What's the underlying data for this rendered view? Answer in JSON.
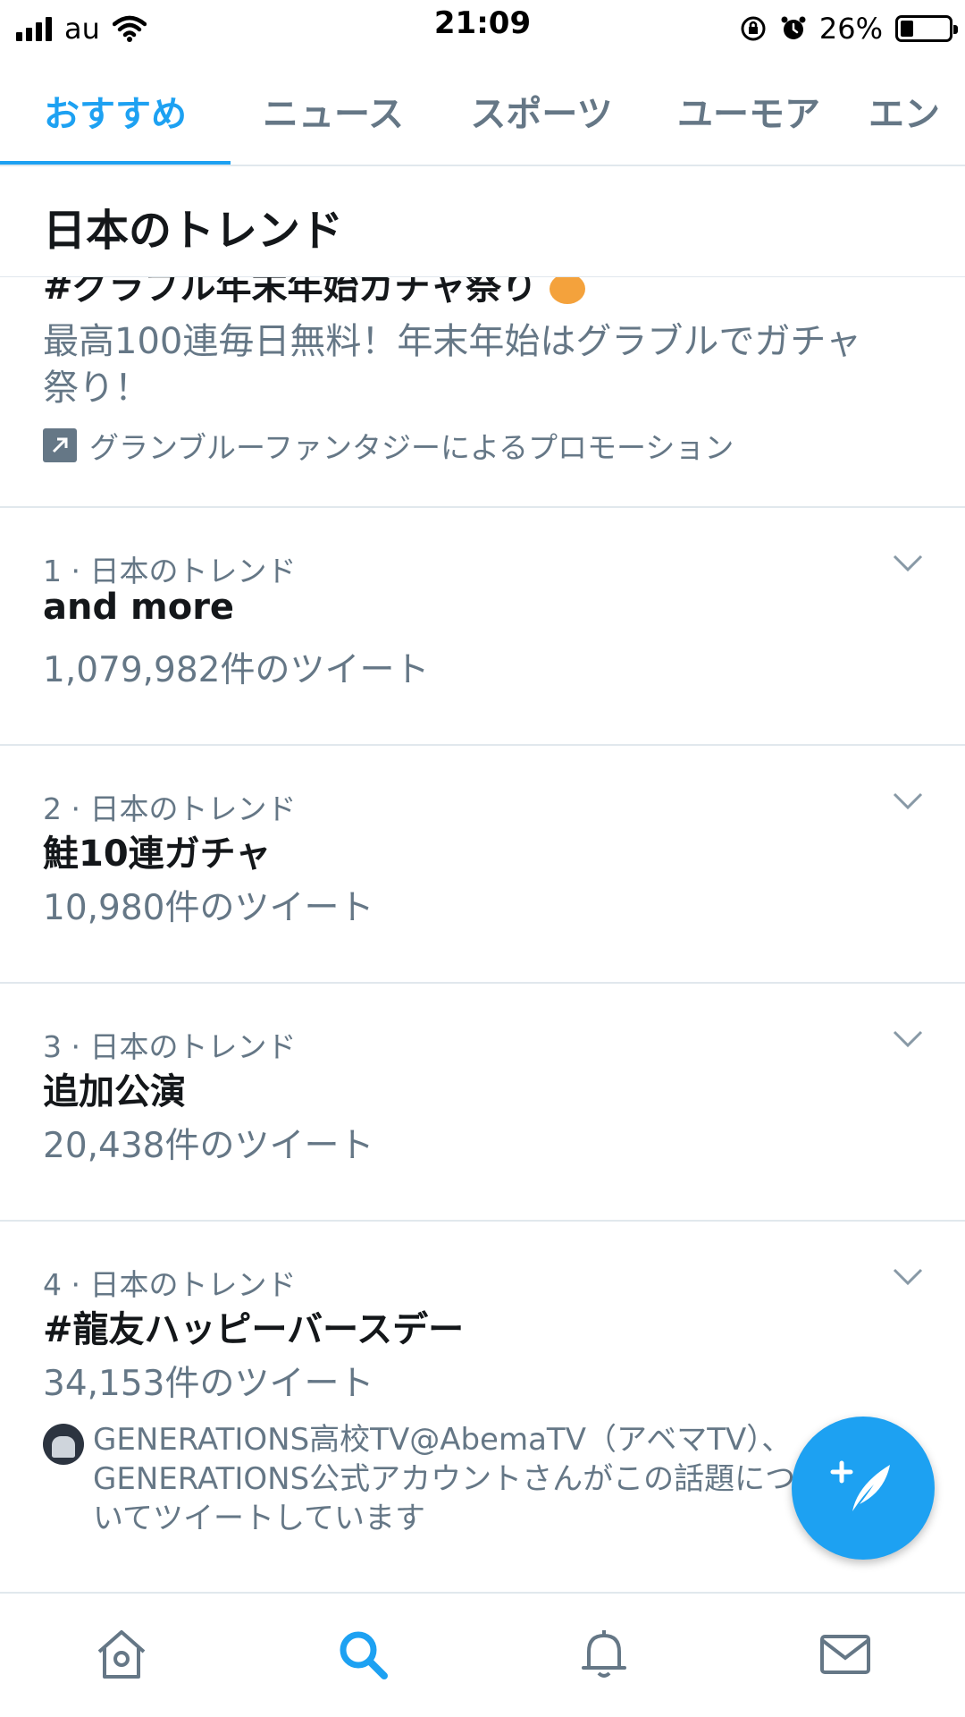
{
  "status_bar": {
    "carrier": "au",
    "time": "21:09",
    "battery_percent": "26%",
    "battery_level": 0.26,
    "icons": [
      "signal-icon",
      "wifi-icon",
      "orientation-lock-icon",
      "alarm-icon",
      "battery-icon"
    ]
  },
  "tabs": [
    {
      "label": "おすすめ",
      "active": true
    },
    {
      "label": "ニュース",
      "active": false
    },
    {
      "label": "スポーツ",
      "active": false
    },
    {
      "label": "ユーモア",
      "active": false
    },
    {
      "label": "エン",
      "active": false
    }
  ],
  "section": {
    "title": "日本のトレンド"
  },
  "promoted": {
    "tag": "#グラブル年末年始ガチャ祭り",
    "description": "最高100連毎日無料！年末年始はグラブルでガチャ祭り！",
    "promoted_by": "グランブルーファンタジーによるプロモーション"
  },
  "trends": [
    {
      "meta": "1 · 日本のトレンド",
      "name": "and more",
      "count": "1,079,982件のツイート"
    },
    {
      "meta": "2 · 日本のトレンド",
      "name": "鮭10連ガチャ",
      "count": "10,980件のツイート"
    },
    {
      "meta": "3 · 日本のトレンド",
      "name": "追加公演",
      "count": "20,438件のツイート"
    },
    {
      "meta": "4 · 日本のトレンド",
      "name": "#龍友ハッピーバースデー",
      "count": "34,153件のツイート",
      "context": "GENERATIONS高校TV@AbemaTV（アベマTV）、GENERATIONS公式アカウントさんがこの話題についてツイートしています"
    }
  ],
  "bottom_nav": [
    {
      "icon": "home-icon",
      "active": false
    },
    {
      "icon": "search-icon",
      "active": true
    },
    {
      "icon": "notifications-icon",
      "active": false
    },
    {
      "icon": "messages-icon",
      "active": false
    }
  ],
  "colors": {
    "accent": "#1da1f2",
    "secondary_text": "#657786",
    "divider": "#e1e8ed"
  }
}
